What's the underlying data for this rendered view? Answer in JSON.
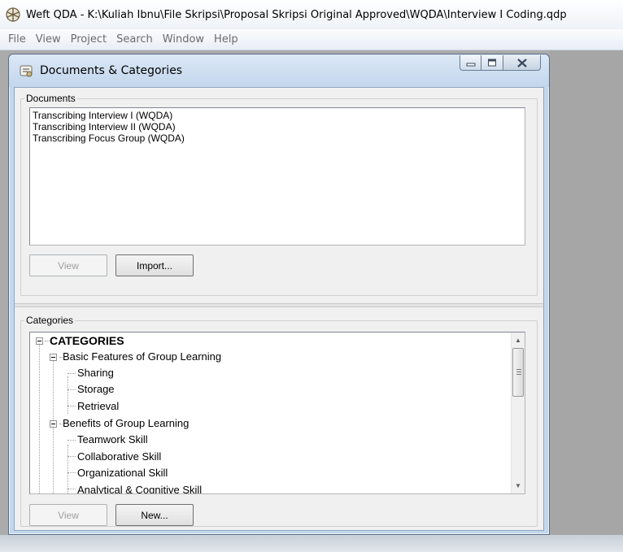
{
  "app": {
    "title": "Weft QDA - K:\\Kuliah Ibnu\\File Skripsi\\Proposal Skripsi Original Approved\\WQDA\\Interview I Coding.qdp"
  },
  "menu": {
    "items": [
      "File",
      "View",
      "Project",
      "Search",
      "Window",
      "Help"
    ]
  },
  "window": {
    "title": "Documents & Categories"
  },
  "documents": {
    "label": "Documents",
    "items": [
      "Transcribing Interview I (WQDA)",
      "Transcribing Interview II (WQDA)",
      "Transcribing Focus Group (WQDA)"
    ],
    "view_label": "View",
    "import_label": "Import..."
  },
  "categories": {
    "label": "Categories",
    "root": "CATEGORIES",
    "groups": [
      {
        "label": "Basic Features of Group Learning",
        "children": [
          "Sharing",
          "Storage",
          "Retrieval"
        ]
      },
      {
        "label": "Benefits of Group Learning",
        "children": [
          "Teamwork Skill",
          "Collaborative Skill",
          "Organizational Skill",
          "Analytical & Cognitive Skill"
        ]
      }
    ],
    "view_label": "View",
    "new_label": "New..."
  },
  "colors": {
    "window_frame": "#c4d7ec",
    "mdi_background": "#ababab",
    "disabled_text": "#a0a0a0"
  }
}
